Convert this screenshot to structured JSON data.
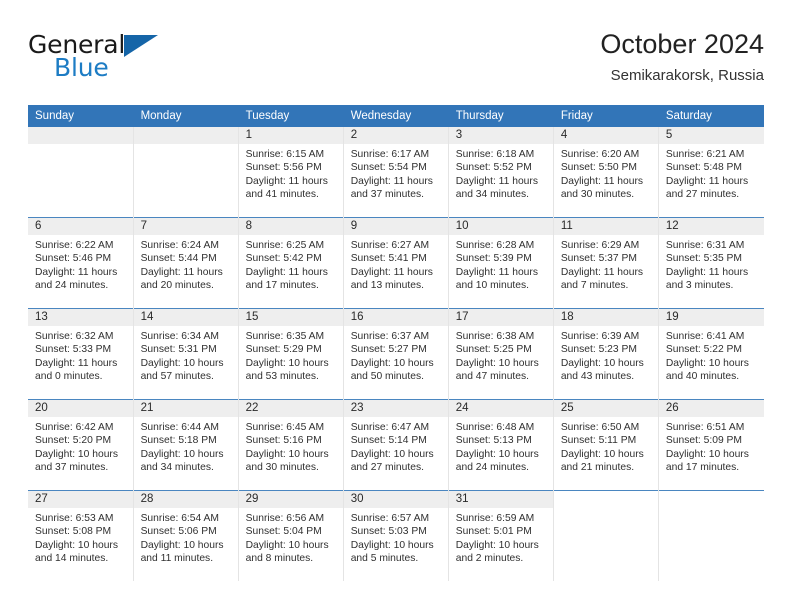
{
  "brand": {
    "name_top": "General",
    "name_bottom": "Blue",
    "color_dark": "#1a1a1a",
    "color_blue": "#1d7cc4",
    "triangle_color": "#1565a8"
  },
  "header": {
    "title": "October 2024",
    "subtitle": "Semikarakorsk, Russia"
  },
  "theme": {
    "header_bg": "#3275b8",
    "header_text": "#ffffff",
    "daynum_band_bg": "#eeeeee",
    "row_divider": "#4a86c0",
    "cell_divider": "#e4e4e4"
  },
  "weekdays": [
    "Sunday",
    "Monday",
    "Tuesday",
    "Wednesday",
    "Thursday",
    "Friday",
    "Saturday"
  ],
  "labels": {
    "sunrise_prefix": "Sunrise: ",
    "sunset_prefix": "Sunset: ",
    "daylight_prefix": "Daylight: "
  },
  "weeks": [
    [
      {
        "day": "",
        "sunrise": "",
        "sunset": "",
        "daylight": "",
        "empty": true
      },
      {
        "day": "",
        "sunrise": "",
        "sunset": "",
        "daylight": "",
        "empty": true
      },
      {
        "day": "1",
        "sunrise": "Sunrise: 6:15 AM",
        "sunset": "Sunset: 5:56 PM",
        "daylight": "Daylight: 11 hours and 41 minutes."
      },
      {
        "day": "2",
        "sunrise": "Sunrise: 6:17 AM",
        "sunset": "Sunset: 5:54 PM",
        "daylight": "Daylight: 11 hours and 37 minutes."
      },
      {
        "day": "3",
        "sunrise": "Sunrise: 6:18 AM",
        "sunset": "Sunset: 5:52 PM",
        "daylight": "Daylight: 11 hours and 34 minutes."
      },
      {
        "day": "4",
        "sunrise": "Sunrise: 6:20 AM",
        "sunset": "Sunset: 5:50 PM",
        "daylight": "Daylight: 11 hours and 30 minutes."
      },
      {
        "day": "5",
        "sunrise": "Sunrise: 6:21 AM",
        "sunset": "Sunset: 5:48 PM",
        "daylight": "Daylight: 11 hours and 27 minutes."
      }
    ],
    [
      {
        "day": "6",
        "sunrise": "Sunrise: 6:22 AM",
        "sunset": "Sunset: 5:46 PM",
        "daylight": "Daylight: 11 hours and 24 minutes."
      },
      {
        "day": "7",
        "sunrise": "Sunrise: 6:24 AM",
        "sunset": "Sunset: 5:44 PM",
        "daylight": "Daylight: 11 hours and 20 minutes."
      },
      {
        "day": "8",
        "sunrise": "Sunrise: 6:25 AM",
        "sunset": "Sunset: 5:42 PM",
        "daylight": "Daylight: 11 hours and 17 minutes."
      },
      {
        "day": "9",
        "sunrise": "Sunrise: 6:27 AM",
        "sunset": "Sunset: 5:41 PM",
        "daylight": "Daylight: 11 hours and 13 minutes."
      },
      {
        "day": "10",
        "sunrise": "Sunrise: 6:28 AM",
        "sunset": "Sunset: 5:39 PM",
        "daylight": "Daylight: 11 hours and 10 minutes."
      },
      {
        "day": "11",
        "sunrise": "Sunrise: 6:29 AM",
        "sunset": "Sunset: 5:37 PM",
        "daylight": "Daylight: 11 hours and 7 minutes."
      },
      {
        "day": "12",
        "sunrise": "Sunrise: 6:31 AM",
        "sunset": "Sunset: 5:35 PM",
        "daylight": "Daylight: 11 hours and 3 minutes."
      }
    ],
    [
      {
        "day": "13",
        "sunrise": "Sunrise: 6:32 AM",
        "sunset": "Sunset: 5:33 PM",
        "daylight": "Daylight: 11 hours and 0 minutes."
      },
      {
        "day": "14",
        "sunrise": "Sunrise: 6:34 AM",
        "sunset": "Sunset: 5:31 PM",
        "daylight": "Daylight: 10 hours and 57 minutes."
      },
      {
        "day": "15",
        "sunrise": "Sunrise: 6:35 AM",
        "sunset": "Sunset: 5:29 PM",
        "daylight": "Daylight: 10 hours and 53 minutes."
      },
      {
        "day": "16",
        "sunrise": "Sunrise: 6:37 AM",
        "sunset": "Sunset: 5:27 PM",
        "daylight": "Daylight: 10 hours and 50 minutes."
      },
      {
        "day": "17",
        "sunrise": "Sunrise: 6:38 AM",
        "sunset": "Sunset: 5:25 PM",
        "daylight": "Daylight: 10 hours and 47 minutes."
      },
      {
        "day": "18",
        "sunrise": "Sunrise: 6:39 AM",
        "sunset": "Sunset: 5:23 PM",
        "daylight": "Daylight: 10 hours and 43 minutes."
      },
      {
        "day": "19",
        "sunrise": "Sunrise: 6:41 AM",
        "sunset": "Sunset: 5:22 PM",
        "daylight": "Daylight: 10 hours and 40 minutes."
      }
    ],
    [
      {
        "day": "20",
        "sunrise": "Sunrise: 6:42 AM",
        "sunset": "Sunset: 5:20 PM",
        "daylight": "Daylight: 10 hours and 37 minutes."
      },
      {
        "day": "21",
        "sunrise": "Sunrise: 6:44 AM",
        "sunset": "Sunset: 5:18 PM",
        "daylight": "Daylight: 10 hours and 34 minutes."
      },
      {
        "day": "22",
        "sunrise": "Sunrise: 6:45 AM",
        "sunset": "Sunset: 5:16 PM",
        "daylight": "Daylight: 10 hours and 30 minutes."
      },
      {
        "day": "23",
        "sunrise": "Sunrise: 6:47 AM",
        "sunset": "Sunset: 5:14 PM",
        "daylight": "Daylight: 10 hours and 27 minutes."
      },
      {
        "day": "24",
        "sunrise": "Sunrise: 6:48 AM",
        "sunset": "Sunset: 5:13 PM",
        "daylight": "Daylight: 10 hours and 24 minutes."
      },
      {
        "day": "25",
        "sunrise": "Sunrise: 6:50 AM",
        "sunset": "Sunset: 5:11 PM",
        "daylight": "Daylight: 10 hours and 21 minutes."
      },
      {
        "day": "26",
        "sunrise": "Sunrise: 6:51 AM",
        "sunset": "Sunset: 5:09 PM",
        "daylight": "Daylight: 10 hours and 17 minutes."
      }
    ],
    [
      {
        "day": "27",
        "sunrise": "Sunrise: 6:53 AM",
        "sunset": "Sunset: 5:08 PM",
        "daylight": "Daylight: 10 hours and 14 minutes."
      },
      {
        "day": "28",
        "sunrise": "Sunrise: 6:54 AM",
        "sunset": "Sunset: 5:06 PM",
        "daylight": "Daylight: 10 hours and 11 minutes."
      },
      {
        "day": "29",
        "sunrise": "Sunrise: 6:56 AM",
        "sunset": "Sunset: 5:04 PM",
        "daylight": "Daylight: 10 hours and 8 minutes."
      },
      {
        "day": "30",
        "sunrise": "Sunrise: 6:57 AM",
        "sunset": "Sunset: 5:03 PM",
        "daylight": "Daylight: 10 hours and 5 minutes."
      },
      {
        "day": "31",
        "sunrise": "Sunrise: 6:59 AM",
        "sunset": "Sunset: 5:01 PM",
        "daylight": "Daylight: 10 hours and 2 minutes."
      },
      {
        "day": "",
        "sunrise": "",
        "sunset": "",
        "daylight": "",
        "blank": true
      },
      {
        "day": "",
        "sunrise": "",
        "sunset": "",
        "daylight": "",
        "blank": true
      }
    ]
  ]
}
